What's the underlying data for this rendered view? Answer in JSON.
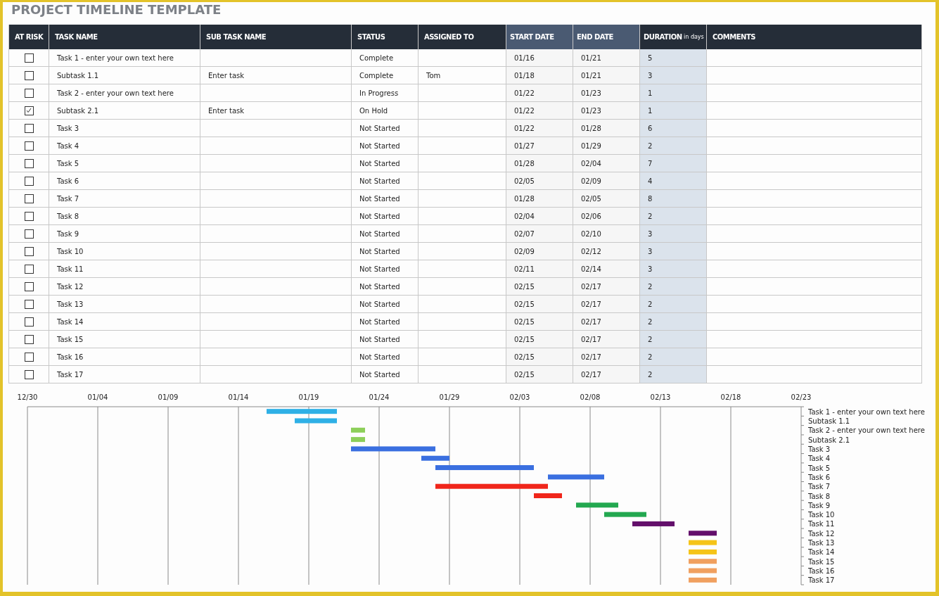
{
  "title": "PROJECT TIMELINE TEMPLATE",
  "table": {
    "columns": [
      {
        "label": "AT RISK",
        "kind": "check",
        "highlight": false
      },
      {
        "label": "TASK NAME",
        "kind": "text",
        "highlight": false
      },
      {
        "label": "SUB TASK NAME",
        "kind": "text",
        "highlight": false
      },
      {
        "label": "STATUS",
        "kind": "text",
        "highlight": false
      },
      {
        "label": "ASSIGNED TO",
        "kind": "text",
        "highlight": false
      },
      {
        "label": "START DATE",
        "kind": "start",
        "highlight": true
      },
      {
        "label": "END DATE",
        "kind": "end",
        "highlight": true
      },
      {
        "label": "DURATION",
        "unit": "in days",
        "kind": "duration",
        "highlight": false
      },
      {
        "label": "COMMENTS",
        "kind": "text",
        "highlight": false
      }
    ],
    "rows": [
      {
        "at_risk": false,
        "cells": [
          "",
          "Task 1 - enter your own text here",
          "",
          "Complete",
          "",
          "01/16",
          "01/21",
          "5",
          ""
        ]
      },
      {
        "at_risk": false,
        "cells": [
          "",
          "Subtask 1.1",
          "Enter task",
          "Complete",
          "Tom",
          "01/18",
          "01/21",
          "3",
          ""
        ]
      },
      {
        "at_risk": false,
        "cells": [
          "",
          "Task 2 - enter your own text here",
          "",
          "In Progress",
          "",
          "01/22",
          "01/23",
          "1",
          ""
        ]
      },
      {
        "at_risk": true,
        "cells": [
          "",
          "Subtask 2.1",
          "Enter task",
          "On Hold",
          "",
          "01/22",
          "01/23",
          "1",
          ""
        ]
      },
      {
        "at_risk": false,
        "cells": [
          "",
          "Task 3",
          "",
          "Not Started",
          "",
          "01/22",
          "01/28",
          "6",
          ""
        ]
      },
      {
        "at_risk": false,
        "cells": [
          "",
          "Task 4",
          "",
          "Not Started",
          "",
          "01/27",
          "01/29",
          "2",
          ""
        ]
      },
      {
        "at_risk": false,
        "cells": [
          "",
          "Task 5",
          "",
          "Not Started",
          "",
          "01/28",
          "02/04",
          "7",
          ""
        ]
      },
      {
        "at_risk": false,
        "cells": [
          "",
          "Task 6",
          "",
          "Not Started",
          "",
          "02/05",
          "02/09",
          "4",
          ""
        ]
      },
      {
        "at_risk": false,
        "cells": [
          "",
          "Task 7",
          "",
          "Not Started",
          "",
          "01/28",
          "02/05",
          "8",
          ""
        ]
      },
      {
        "at_risk": false,
        "cells": [
          "",
          "Task 8",
          "",
          "Not Started",
          "",
          "02/04",
          "02/06",
          "2",
          ""
        ]
      },
      {
        "at_risk": false,
        "cells": [
          "",
          "Task 9",
          "",
          "Not Started",
          "",
          "02/07",
          "02/10",
          "3",
          ""
        ]
      },
      {
        "at_risk": false,
        "cells": [
          "",
          "Task 10",
          "",
          "Not Started",
          "",
          "02/09",
          "02/12",
          "3",
          ""
        ]
      },
      {
        "at_risk": false,
        "cells": [
          "",
          "Task 11",
          "",
          "Not Started",
          "",
          "02/11",
          "02/14",
          "3",
          ""
        ]
      },
      {
        "at_risk": false,
        "cells": [
          "",
          "Task 12",
          "",
          "Not Started",
          "",
          "02/15",
          "02/17",
          "2",
          ""
        ]
      },
      {
        "at_risk": false,
        "cells": [
          "",
          "Task 13",
          "",
          "Not Started",
          "",
          "02/15",
          "02/17",
          "2",
          ""
        ]
      },
      {
        "at_risk": false,
        "cells": [
          "",
          "Task 14",
          "",
          "Not Started",
          "",
          "02/15",
          "02/17",
          "2",
          ""
        ]
      },
      {
        "at_risk": false,
        "cells": [
          "",
          "Task 15",
          "",
          "Not Started",
          "",
          "02/15",
          "02/17",
          "2",
          ""
        ]
      },
      {
        "at_risk": false,
        "cells": [
          "",
          "Task 16",
          "",
          "Not Started",
          "",
          "02/15",
          "02/17",
          "2",
          ""
        ]
      },
      {
        "at_risk": false,
        "cells": [
          "",
          "Task 17",
          "",
          "Not Started",
          "",
          "02/15",
          "02/17",
          "2",
          ""
        ]
      }
    ]
  },
  "timeline": {
    "ticks": [
      "12/30",
      "01/04",
      "01/09",
      "01/14",
      "01/19",
      "01/24",
      "01/29",
      "02/03",
      "02/08",
      "02/13",
      "02/18",
      "02/23"
    ],
    "tasks": [
      {
        "label": "Task 1 - enter your own text here",
        "color": "#2fb0e6"
      },
      {
        "label": "Subtask 1.1",
        "color": "#2fb0e6"
      },
      {
        "label": "Task 2 - enter your own text here",
        "color": "#8dcf5a"
      },
      {
        "label": "Subtask 2.1",
        "color": "#8dcf5a"
      },
      {
        "label": "Task 3",
        "color": "#3a6fe0"
      },
      {
        "label": "Task 4",
        "color": "#3a6fe0"
      },
      {
        "label": "Task 5",
        "color": "#3a6fe0"
      },
      {
        "label": "Task 6",
        "color": "#3a6fe0"
      },
      {
        "label": "Task 7",
        "color": "#f0261b"
      },
      {
        "label": "Task 8",
        "color": "#f0261b"
      },
      {
        "label": "Task 9",
        "color": "#23a850"
      },
      {
        "label": "Task 10",
        "color": "#23a850"
      },
      {
        "label": "Task 11",
        "color": "#630f6b"
      },
      {
        "label": "Task 12",
        "color": "#630f6b"
      },
      {
        "label": "Task 13",
        "color": "#f5c418"
      },
      {
        "label": "Task 14",
        "color": "#f5c418"
      },
      {
        "label": "Task 15",
        "color": "#f0a060"
      },
      {
        "label": "Task 16",
        "color": "#f0a060"
      },
      {
        "label": "Task 17",
        "color": "#f0a060"
      }
    ]
  }
}
